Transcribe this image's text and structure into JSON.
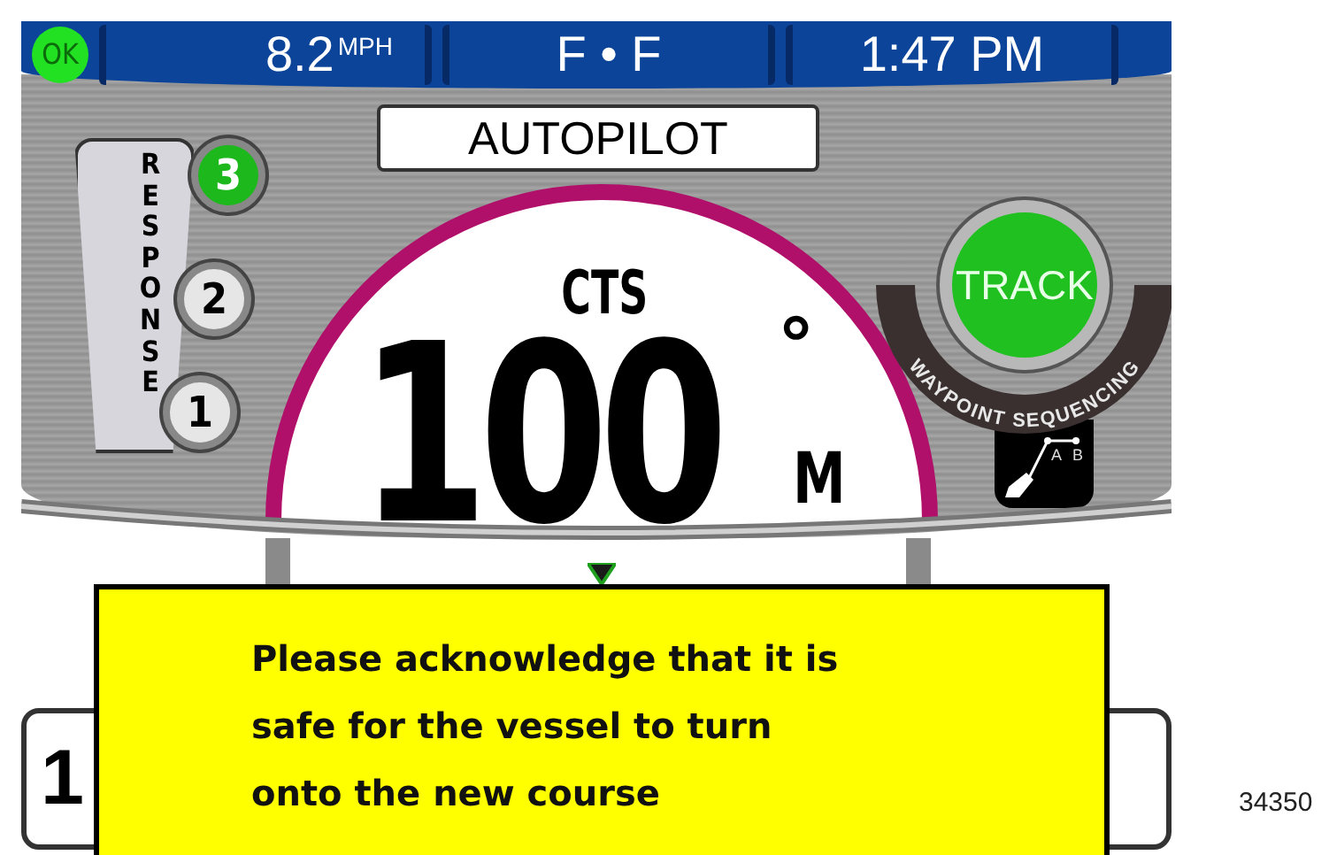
{
  "status_bar": {
    "ok": "OK",
    "speed": "8.2",
    "speed_unit": "MPH",
    "fuel": "F • F",
    "time": "1:47 PM"
  },
  "mode_title": "AUTOPILOT",
  "response": {
    "label": "RESPONSE",
    "levels": [
      {
        "label": "3",
        "selected": true
      },
      {
        "label": "2",
        "selected": false
      },
      {
        "label": "1",
        "selected": false
      }
    ]
  },
  "heading": {
    "label": "CTS",
    "value": "100",
    "degree": "°",
    "unit": "M"
  },
  "track": {
    "label": "TRACK",
    "on": true,
    "caption": "WAYPOINT SEQUENCING",
    "point_a": "A",
    "point_b": "B"
  },
  "side_readouts": [
    {
      "text": "1"
    }
  ],
  "dialog": {
    "message": "Please acknowledge that it is safe for the vessel to turn onto the new course"
  },
  "figure_number": "34350"
}
